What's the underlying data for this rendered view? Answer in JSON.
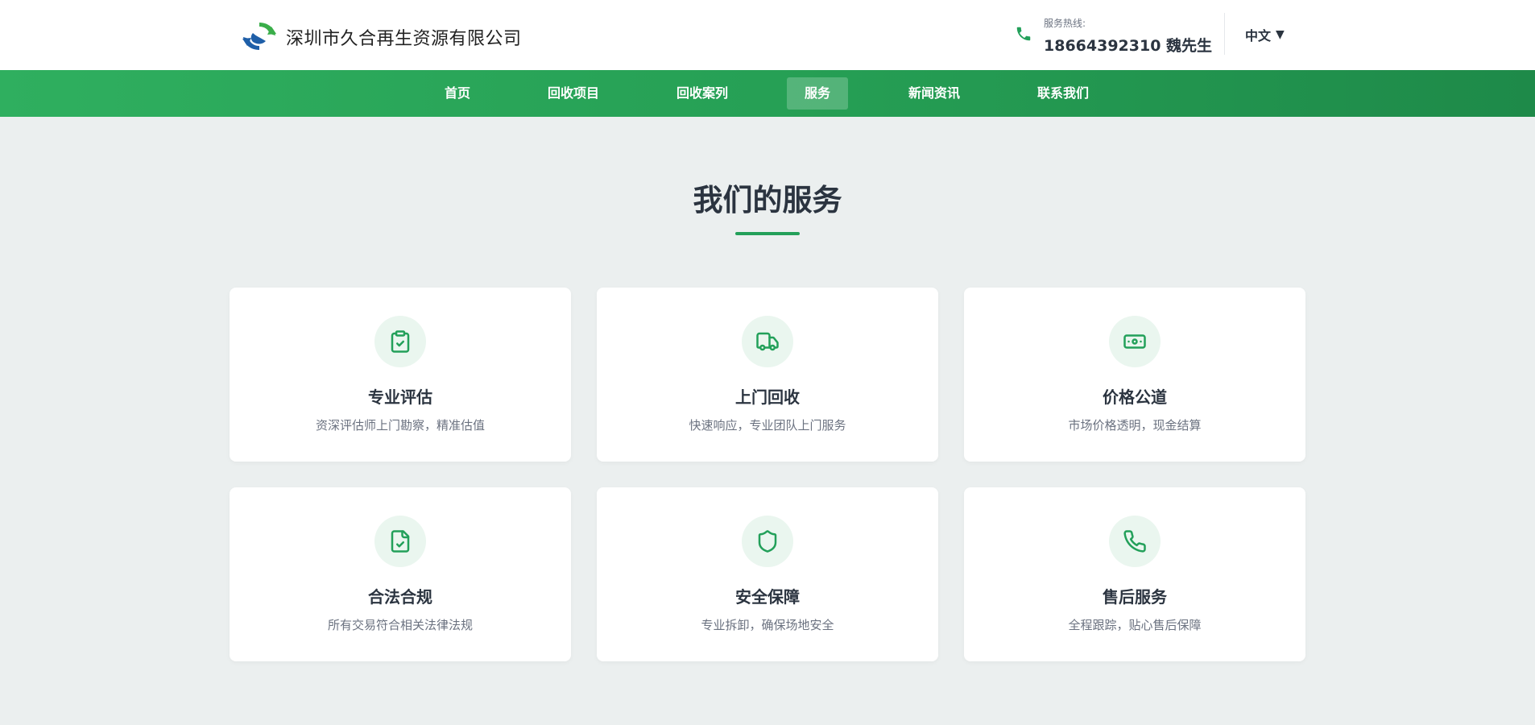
{
  "header": {
    "company_name": "深圳市久合再生资源有限公司",
    "hotline_label": "服务热线:",
    "hotline_number": "18664392310 魏先生",
    "language": "中文"
  },
  "nav": {
    "items": [
      {
        "label": "首页"
      },
      {
        "label": "回收项目"
      },
      {
        "label": "回收案列"
      },
      {
        "label": "服务",
        "active": true
      },
      {
        "label": "新闻资讯"
      },
      {
        "label": "联系我们"
      }
    ]
  },
  "services": {
    "title": "我们的服务",
    "items": [
      {
        "icon": "clipboard-check-icon",
        "title": "专业评估",
        "desc": "资深评估师上门勘察，精准估值"
      },
      {
        "icon": "truck-icon",
        "title": "上门回收",
        "desc": "快速响应，专业团队上门服务"
      },
      {
        "icon": "banknote-icon",
        "title": "价格公道",
        "desc": "市场价格透明，现金结算"
      },
      {
        "icon": "file-check-icon",
        "title": "合法合规",
        "desc": "所有交易符合相关法律法规"
      },
      {
        "icon": "shield-icon",
        "title": "安全保障",
        "desc": "专业拆卸，确保场地安全"
      },
      {
        "icon": "phone-icon",
        "title": "售后服务",
        "desc": "全程跟踪，贴心售后保障"
      }
    ]
  },
  "colors": {
    "brand_green": "#23a05a",
    "nav_gradient_start": "#2faf5f",
    "nav_gradient_end": "#1e8a49",
    "page_background": "#ebefef",
    "icon_circle": "#eaf6ef"
  }
}
